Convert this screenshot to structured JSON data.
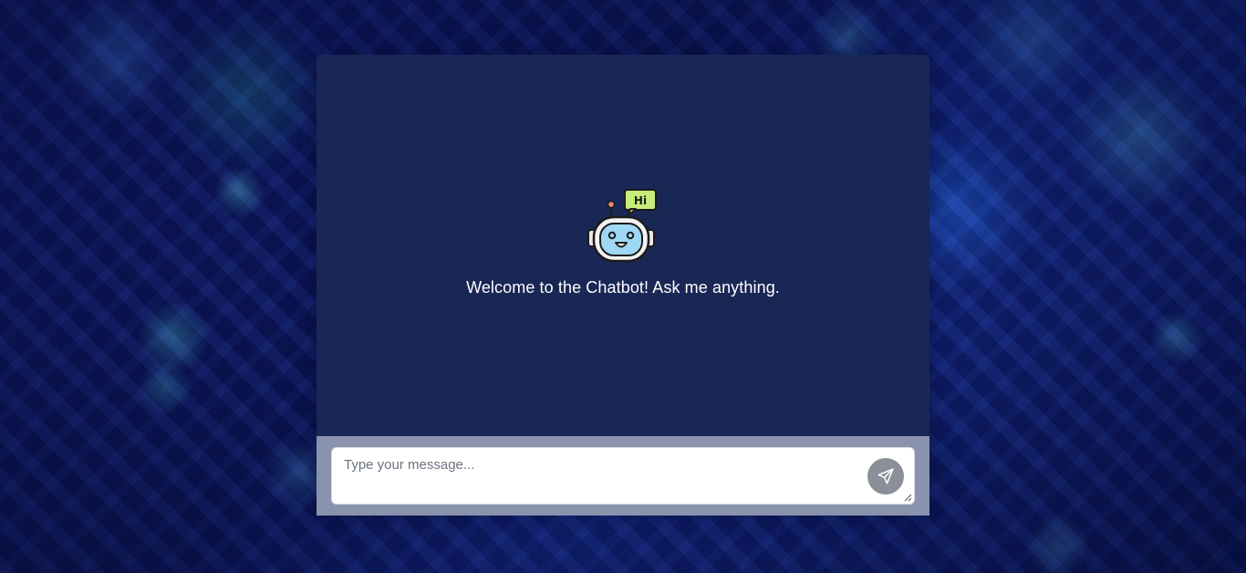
{
  "chat": {
    "welcome_message": "Welcome to the Chatbot! Ask me anything.",
    "bot_avatar_bubble": "Hi",
    "bot_avatar_icon": "robot-icon"
  },
  "composer": {
    "placeholder": "Type your message...",
    "value": "",
    "send_icon": "send-icon"
  },
  "colors": {
    "panel_background": "#192755",
    "composer_background": "#8a93ad",
    "send_button": "#8a8f99",
    "bubble_green": "#c6ec7a"
  }
}
